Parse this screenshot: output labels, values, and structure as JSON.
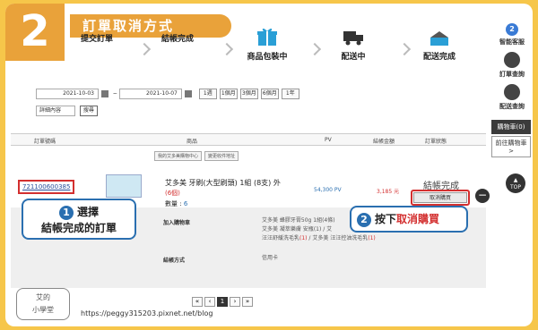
{
  "header": {
    "step_number": "2",
    "title": "訂單取消方式",
    "steps": [
      "提交訂單",
      "結帳完成",
      "商品包裝中",
      "配送中",
      "配送完成"
    ]
  },
  "sidebar": {
    "chat_count": "2",
    "items": [
      "智能客服",
      "訂單查詢",
      "配送查詢"
    ],
    "cart_label": "購物車(0)",
    "cart_link": "前往購物車 >",
    "top_label": "TOP"
  },
  "filters": {
    "date_from": "2021-10-03",
    "date_sep": "~",
    "date_to": "2021-10-07",
    "quick_buttons": [
      "1週",
      "1個月",
      "3個月",
      "6個月",
      "1年"
    ],
    "detail_select": "詳細內容",
    "search_button": "搜尋"
  },
  "table": {
    "headers": [
      "訂單號碼",
      "商品",
      "PV",
      "結帳金額",
      "訂單狀態"
    ],
    "order_no": "721100600385",
    "tags": [
      "我的艾多美購物中心",
      "變更收件地址"
    ],
    "product_name": "艾多美 牙刷(大型刷頭) 1組 (8支) 外",
    "product_qty": "(6個)",
    "count_label": "數量 : ",
    "count_value": "6",
    "pv": "54,300 PV",
    "amount": "3,185 元",
    "status": "結帳完成",
    "cancel_button": "取消購買",
    "minus": "−"
  },
  "extra": {
    "add_cart_label": "加入購物車",
    "add_cart_line1": "艾多美 蜂膠牙膏50g 1組(4條)",
    "add_cart_line2": "艾多美 凝萃樂膚 安瓶(1) / 艾",
    "add_cart_line3a": "汪汪舒緩洗毛乳",
    "add_cart_line3b": "(1)",
    "add_cart_line3c": " / 艾多美 汪汪控油洗毛乳",
    "add_cart_line3d": "(1)",
    "pay_label": "結帳方式",
    "pay_value": "信用卡"
  },
  "pager": {
    "first": "«",
    "prev": "‹",
    "current": "1",
    "next": "›",
    "last": "»"
  },
  "footer": {
    "url": "https://peggy315203.pixnet.net/blog",
    "logo_text_1": "艾的",
    "logo_text_2": "小學堂"
  },
  "callouts": {
    "c1_num": "1",
    "c1_line1": "選擇",
    "c1_line2": "結帳完成的訂單",
    "c2_num": "2",
    "c2_text": "按下",
    "c2_highlight": "取消購買"
  },
  "colors": {
    "accent_orange": "#e9a23a",
    "callout_blue": "#2a6fb0",
    "highlight_red": "#d32f2f",
    "page_yellow": "#f6c64a"
  }
}
